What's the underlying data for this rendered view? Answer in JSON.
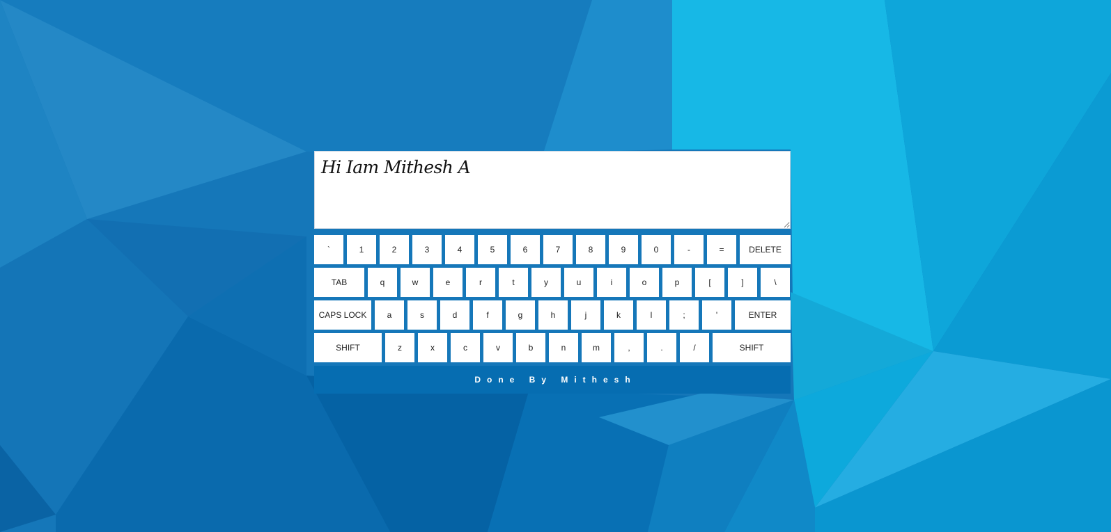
{
  "background": {
    "base_color": "#1577b9",
    "palette": [
      "#1577b9",
      "#066db1",
      "#17b8e6",
      "#2288c7",
      "#0a9fd6",
      "#24aee2",
      "#0f7fc0"
    ]
  },
  "editor": {
    "value": "Hi Iam Mithesh A",
    "font_style": "handwritten-script"
  },
  "keyboard": {
    "rows": [
      [
        {
          "label": "`",
          "name": "key-backtick"
        },
        {
          "label": "1",
          "name": "key-1"
        },
        {
          "label": "2",
          "name": "key-2"
        },
        {
          "label": "3",
          "name": "key-3"
        },
        {
          "label": "4",
          "name": "key-4"
        },
        {
          "label": "5",
          "name": "key-5"
        },
        {
          "label": "6",
          "name": "key-6"
        },
        {
          "label": "7",
          "name": "key-7"
        },
        {
          "label": "8",
          "name": "key-8"
        },
        {
          "label": "9",
          "name": "key-9"
        },
        {
          "label": "0",
          "name": "key-0"
        },
        {
          "label": "-",
          "name": "key-minus"
        },
        {
          "label": "=",
          "name": "key-equals"
        },
        {
          "label": "DELETE",
          "name": "key-delete",
          "cls": "w-delete"
        }
      ],
      [
        {
          "label": "TAB",
          "name": "key-tab",
          "cls": "w-tab"
        },
        {
          "label": "q",
          "name": "key-q"
        },
        {
          "label": "w",
          "name": "key-w"
        },
        {
          "label": "e",
          "name": "key-e"
        },
        {
          "label": "r",
          "name": "key-r"
        },
        {
          "label": "t",
          "name": "key-t"
        },
        {
          "label": "y",
          "name": "key-y"
        },
        {
          "label": "u",
          "name": "key-u"
        },
        {
          "label": "i",
          "name": "key-i"
        },
        {
          "label": "o",
          "name": "key-o"
        },
        {
          "label": "p",
          "name": "key-p"
        },
        {
          "label": "[",
          "name": "key-open-bracket"
        },
        {
          "label": "]",
          "name": "key-close-bracket"
        },
        {
          "label": "\\",
          "name": "key-backslash"
        }
      ],
      [
        {
          "label": "CAPS LOCK",
          "name": "key-caps-lock",
          "cls": "w-caps"
        },
        {
          "label": "a",
          "name": "key-a"
        },
        {
          "label": "s",
          "name": "key-s"
        },
        {
          "label": "d",
          "name": "key-d"
        },
        {
          "label": "f",
          "name": "key-f"
        },
        {
          "label": "g",
          "name": "key-g"
        },
        {
          "label": "h",
          "name": "key-h"
        },
        {
          "label": "j",
          "name": "key-j"
        },
        {
          "label": "k",
          "name": "key-k"
        },
        {
          "label": "l",
          "name": "key-l"
        },
        {
          "label": ";",
          "name": "key-semicolon"
        },
        {
          "label": "'",
          "name": "key-quote"
        },
        {
          "label": "ENTER",
          "name": "key-enter",
          "cls": "w-enter"
        }
      ],
      [
        {
          "label": "SHIFT",
          "name": "key-shift-left",
          "cls": "w-shift-l"
        },
        {
          "label": "z",
          "name": "key-z"
        },
        {
          "label": "x",
          "name": "key-x"
        },
        {
          "label": "c",
          "name": "key-c"
        },
        {
          "label": "v",
          "name": "key-v"
        },
        {
          "label": "b",
          "name": "key-b"
        },
        {
          "label": "n",
          "name": "key-n"
        },
        {
          "label": "m",
          "name": "key-m"
        },
        {
          "label": ",",
          "name": "key-comma"
        },
        {
          "label": ".",
          "name": "key-period"
        },
        {
          "label": "/",
          "name": "key-slash"
        },
        {
          "label": "SHIFT",
          "name": "key-shift-right",
          "cls": "w-shift-r"
        }
      ]
    ]
  },
  "footer": {
    "text": "Done By Mithesh",
    "background_color": "#066db1"
  }
}
